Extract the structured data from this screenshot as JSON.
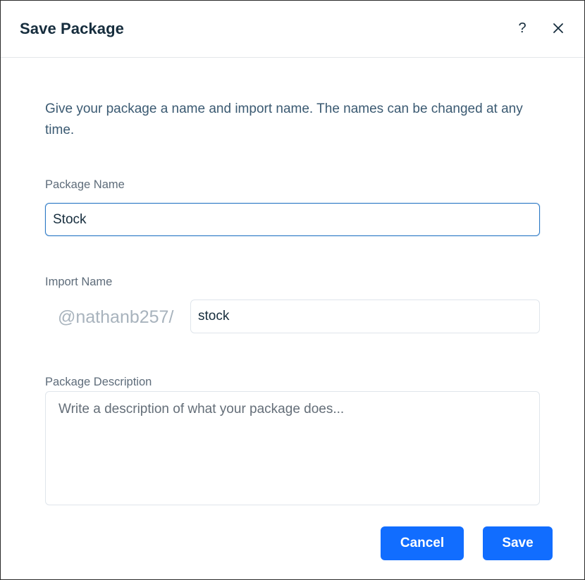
{
  "dialog": {
    "title": "Save Package",
    "help_label": "?",
    "intro": "Give your package a name and import name. The names can be changed at any time."
  },
  "fields": {
    "package_name_label": "Package Name",
    "package_name_value": "Stock",
    "import_name_label": "Import Name",
    "import_prefix": "@nathanb257/",
    "import_name_value": "stock",
    "description_label": "Package Description",
    "description_placeholder": "Write a description of what your package does..."
  },
  "buttons": {
    "cancel": "Cancel",
    "save": "Save"
  },
  "colors": {
    "primary": "#116dff",
    "title": "#162d3d",
    "focus_border": "#2b78c5"
  },
  "icons": {
    "help": "question-mark-icon",
    "close": "close-icon"
  }
}
